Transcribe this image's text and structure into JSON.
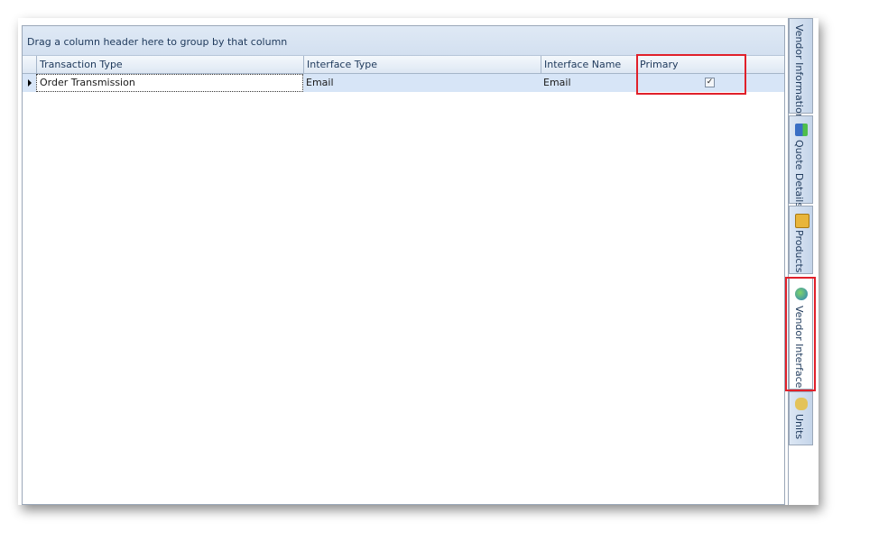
{
  "grid": {
    "group_panel_text": "Drag a column header here to group by that column",
    "columns": [
      "Transaction Type",
      "Interface Type",
      "Interface Name",
      "Primary"
    ],
    "rows": [
      {
        "transaction_type": "Order Transmission",
        "interface_type": "Email",
        "interface_name": "Email",
        "primary": "✓"
      }
    ]
  },
  "tabs": [
    {
      "label": "Vendor Information",
      "icon": "none"
    },
    {
      "label": "Quote Details",
      "icon": "document-chart-icon"
    },
    {
      "label": "Products",
      "icon": "gift-box-icon"
    },
    {
      "label": "Vendor Interface",
      "icon": "globe-link-icon",
      "active": true
    },
    {
      "label": "Units",
      "icon": "pills-icon"
    }
  ],
  "colors": {
    "highlight": "#e0202a",
    "selected_row": "#d7e5f7"
  }
}
